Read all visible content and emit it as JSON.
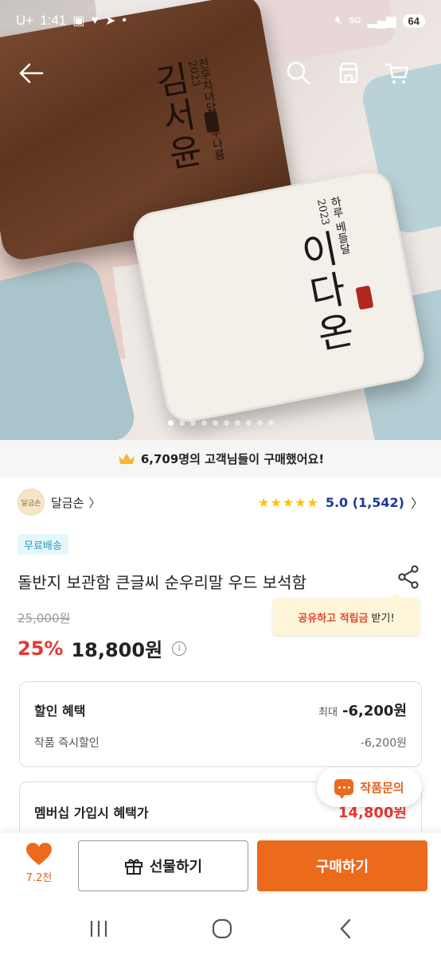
{
  "status_bar": {
    "carrier": "U+",
    "time": "1:41",
    "network": "5G",
    "battery": "64"
  },
  "hero": {
    "wood_box": {
      "name": "김서윤",
      "year": "2023",
      "subtitle": "전우치녀답 스무나름"
    },
    "cream_box": {
      "name": "이다온",
      "year": "2023",
      "subtitle": "하루 베들달"
    },
    "carousel": {
      "total": 10,
      "active": 0
    }
  },
  "buyers_banner": {
    "icon": "crown-icon",
    "text": "6,709명의 고객님들이 구매했어요!"
  },
  "seller": {
    "avatar_text": "달금손",
    "name": "달금손",
    "stars": "★★★★★",
    "rating": "5.0 (1,542)"
  },
  "product": {
    "free_shipping": "무료배송",
    "title": "돌반지 보관함 큰글씨 순우리말 우드 보석함",
    "original_price": "25,000원",
    "discount": "25%",
    "price": "18,800원",
    "info_icon": "i"
  },
  "share_tooltip": {
    "highlight": "공유하고 적립금",
    "rest": "받기!"
  },
  "discount_card": {
    "title": "할인 혜택",
    "max_label": "최대",
    "max_value": "-6,200원",
    "item_label": "작품 즉시할인",
    "item_value": "-6,200원"
  },
  "membership_card": {
    "title": "멤버십 가입시 혜택가",
    "price": "14,800원"
  },
  "inquiry_button": {
    "label": "작품문의"
  },
  "action_bar": {
    "like_count": "7.2천",
    "gift_label": "선물하기",
    "buy_label": "구매하기"
  },
  "colors": {
    "accent": "#ec6a1c",
    "discount_red": "#e6372e",
    "rating_blue": "#1a3a9c",
    "star": "#ffc107"
  }
}
